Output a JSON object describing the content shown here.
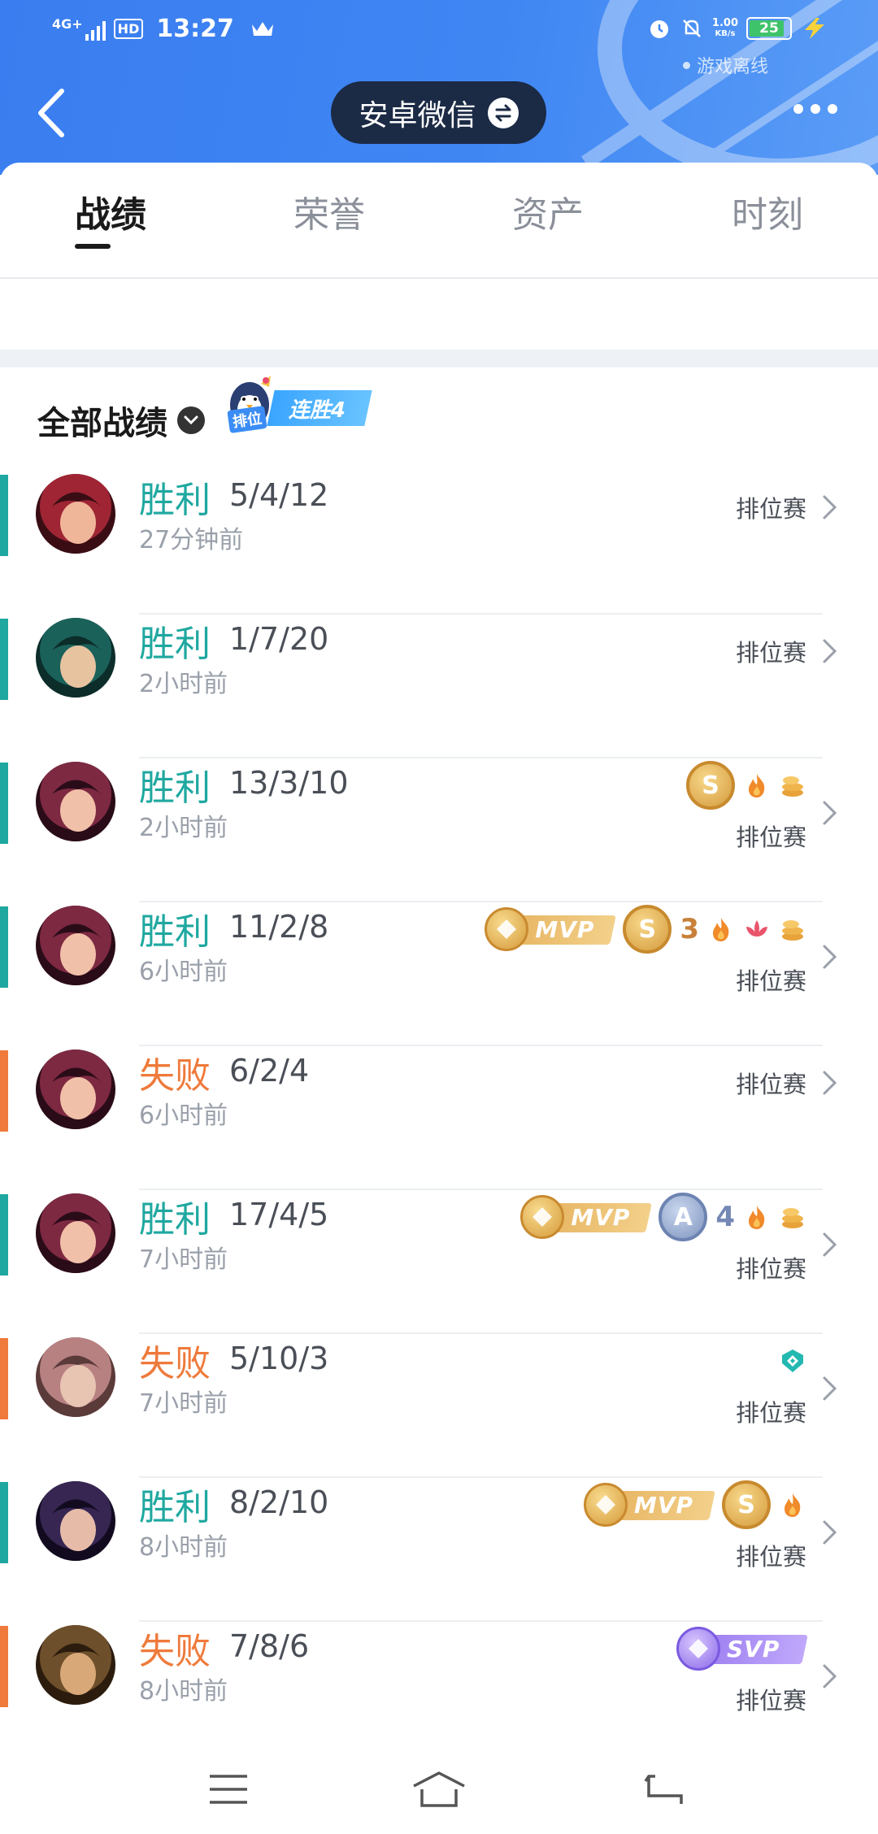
{
  "status_bar": {
    "network": "4G+",
    "hd": "HD",
    "time": "13:27",
    "speed_value": "1.00",
    "speed_unit": "KB/s",
    "battery": "25",
    "offline_text": "游戏离线"
  },
  "header": {
    "account_label": "安卓微信"
  },
  "tabs": [
    "战绩",
    "荣誉",
    "资产",
    "时刻"
  ],
  "section": {
    "title": "全部战绩",
    "streak_tag": "排位",
    "streak_text": "连胜4"
  },
  "matches": [
    {
      "result": "胜利",
      "kda": "5/4/12",
      "time": "27分钟前",
      "mode": "排位赛",
      "outcome": "win",
      "badges": []
    },
    {
      "result": "胜利",
      "kda": "1/7/20",
      "time": "2小时前",
      "mode": "排位赛",
      "outcome": "win",
      "badges": []
    },
    {
      "result": "胜利",
      "kda": "13/3/10",
      "time": "2小时前",
      "mode": "排位赛",
      "outcome": "win",
      "badges": [
        "S",
        "fire",
        "coins"
      ]
    },
    {
      "result": "胜利",
      "kda": "11/2/8",
      "time": "6小时前",
      "mode": "排位赛",
      "outcome": "win",
      "badges": [
        "MVP",
        "S",
        "3",
        "fire",
        "lotus",
        "coins"
      ]
    },
    {
      "result": "失败",
      "kda": "6/2/4",
      "time": "6小时前",
      "mode": "排位赛",
      "outcome": "lose",
      "badges": []
    },
    {
      "result": "胜利",
      "kda": "17/4/5",
      "time": "7小时前",
      "mode": "排位赛",
      "outcome": "win",
      "badges": [
        "MVP",
        "A",
        "4",
        "fire",
        "coins"
      ]
    },
    {
      "result": "失败",
      "kda": "5/10/3",
      "time": "7小时前",
      "mode": "排位赛",
      "outcome": "lose",
      "badges": [
        "shield"
      ]
    },
    {
      "result": "胜利",
      "kda": "8/2/10",
      "time": "8小时前",
      "mode": "排位赛",
      "outcome": "win",
      "badges": [
        "MVP",
        "S",
        "fire"
      ]
    },
    {
      "result": "失败",
      "kda": "7/8/6",
      "time": "8小时前",
      "mode": "排位赛",
      "outcome": "lose",
      "badges": [
        "SVP"
      ]
    }
  ],
  "badge_labels": {
    "mvp": "MVP",
    "svp": "SVP",
    "grade_s": "S",
    "grade_a": "A",
    "rank_3": "3",
    "rank_4": "4"
  },
  "colors": {
    "header_blue": "#3f86f3",
    "win": "#1fa8a0",
    "lose": "#ef7a3b",
    "gold": "#e6b35f",
    "purple": "#9b7cf0"
  }
}
